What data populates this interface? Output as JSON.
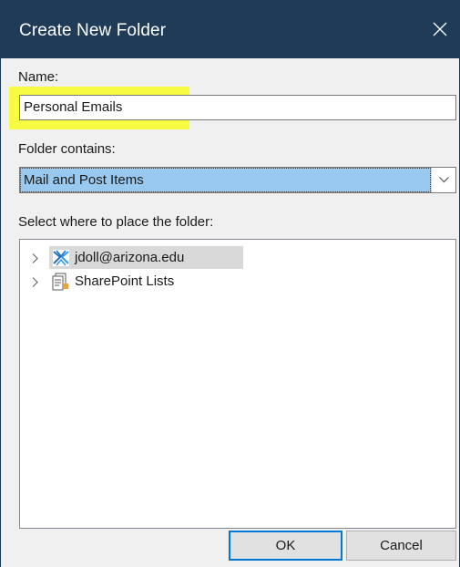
{
  "window": {
    "title": "Create New Folder",
    "close_icon": "close-icon"
  },
  "name_field": {
    "label": "Name:",
    "value": "Personal Emails",
    "highlight_color": "#f7fb41"
  },
  "folder_contains": {
    "label": "Folder contains:",
    "selected": "Mail and Post Items",
    "selected_bg": "#99c9ef"
  },
  "location": {
    "label": "Select where to place the folder:",
    "items": [
      {
        "label": "jdoll@arizona.edu",
        "icon": "mailbox-icon",
        "selected": true
      },
      {
        "label": "SharePoint Lists",
        "icon": "sharepoint-lists-icon",
        "selected": false
      }
    ]
  },
  "buttons": {
    "ok": "OK",
    "cancel": "Cancel"
  },
  "colors": {
    "titlebar": "#1f3b57",
    "dialog_bg": "#f0f0f0",
    "accent": "#0078d7"
  }
}
